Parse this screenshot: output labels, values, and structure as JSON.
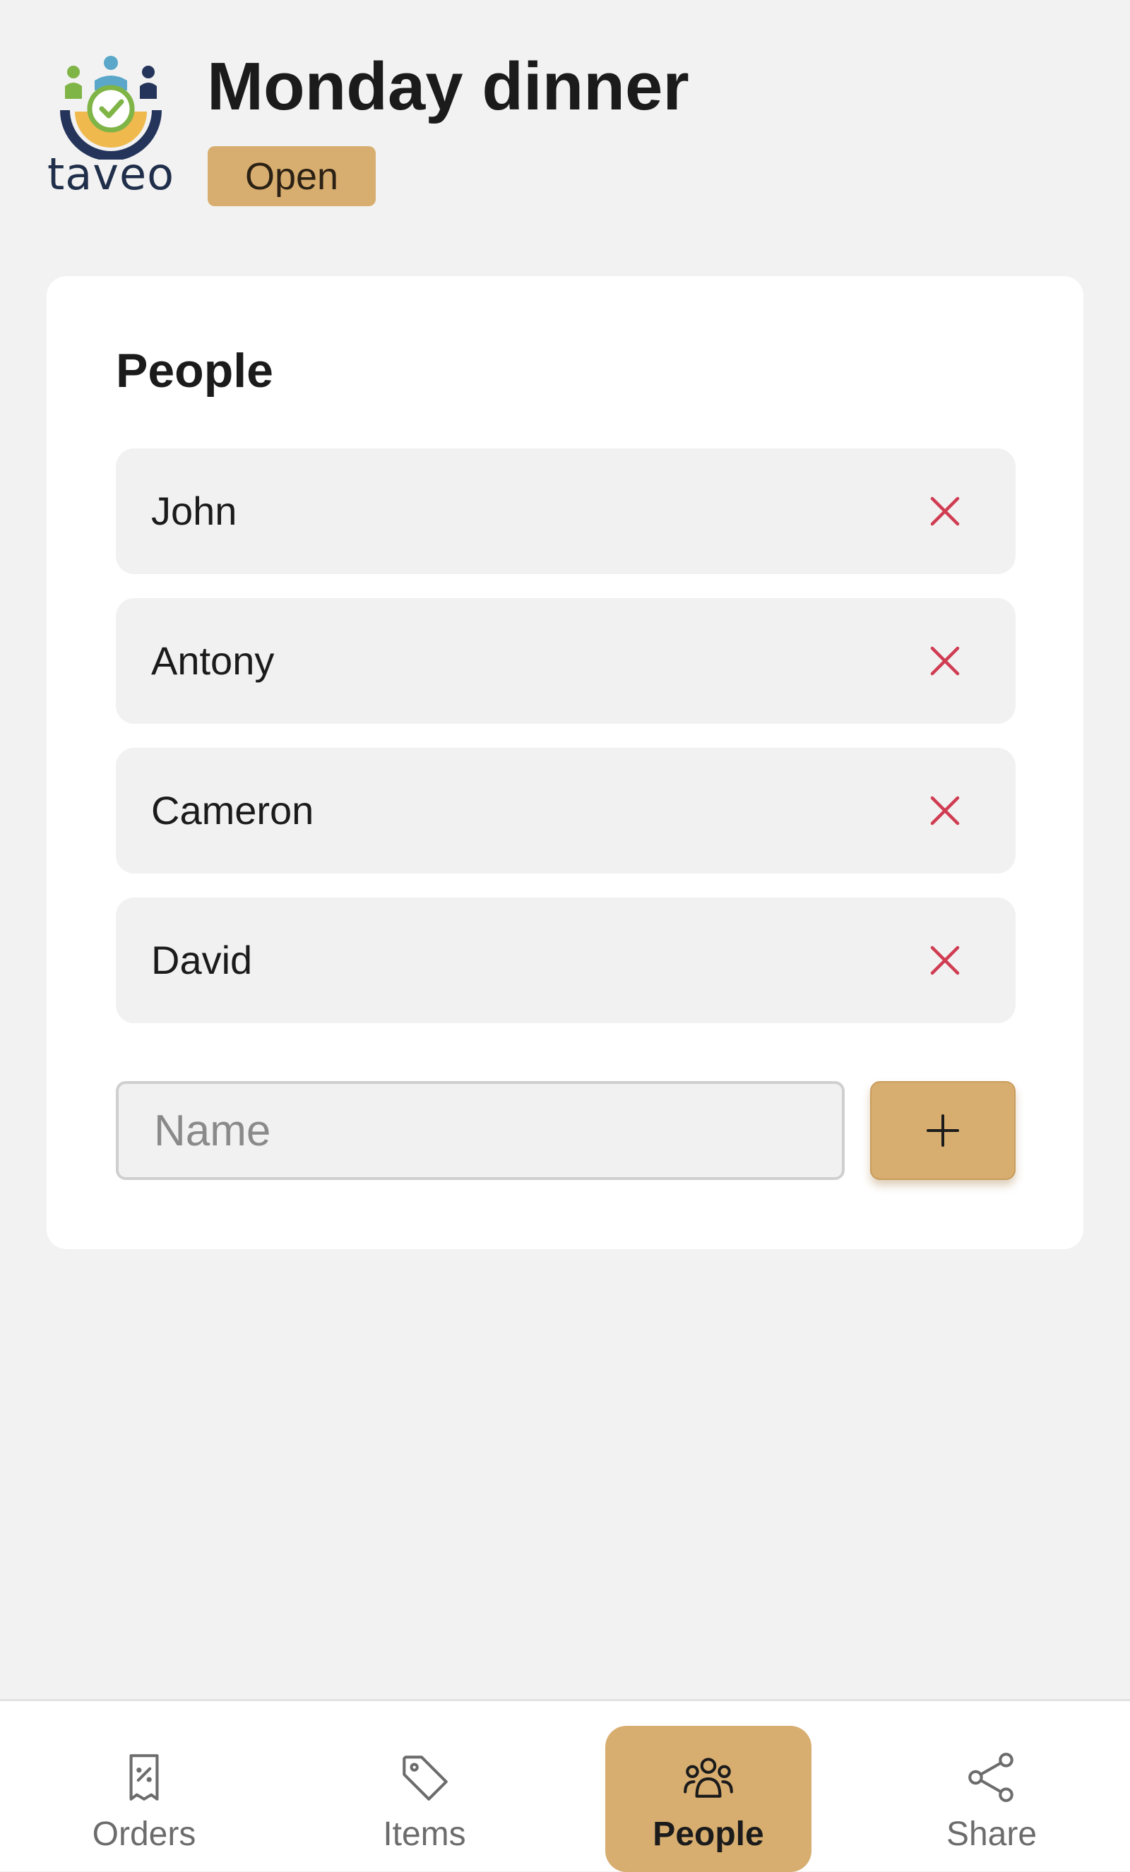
{
  "app": {
    "logo_text": "taveo",
    "title": "Monday dinner",
    "status": "Open"
  },
  "people_section": {
    "title": "People",
    "people": [
      {
        "name": "John"
      },
      {
        "name": "Antony"
      },
      {
        "name": "Cameron"
      },
      {
        "name": "David"
      }
    ],
    "remove_icon": "close-icon",
    "name_input": {
      "value": "",
      "placeholder": "Name"
    },
    "add_icon": "plus-icon"
  },
  "tab_bar": {
    "tabs": [
      {
        "label": "Orders",
        "icon": "receipt-icon",
        "active": false
      },
      {
        "label": "Items",
        "icon": "tag-icon",
        "active": false
      },
      {
        "label": "People",
        "icon": "people-icon",
        "active": true
      },
      {
        "label": "Share",
        "icon": "share-icon",
        "active": false
      }
    ]
  },
  "colors": {
    "accent": "#d8ae70",
    "background": "#f2f2f2",
    "card": "#ffffff",
    "row": "#f1f1f1",
    "remove": "#d03c52",
    "text": "#1b1b1b",
    "muted_text": "#6c6c6c"
  }
}
